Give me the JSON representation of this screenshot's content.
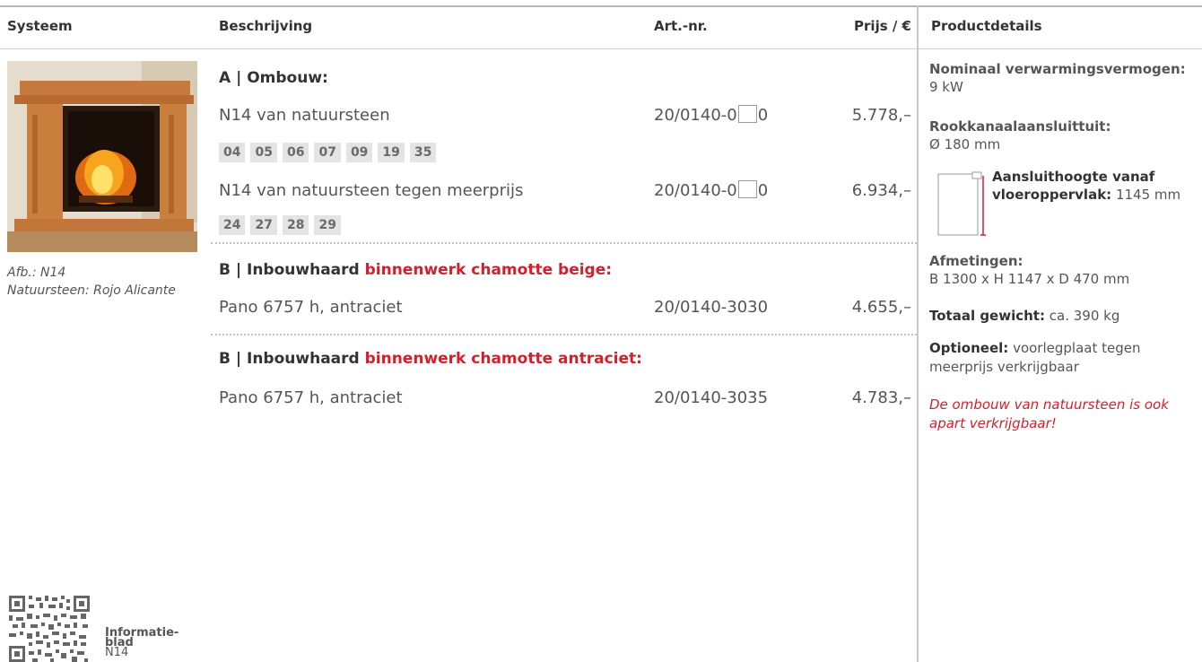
{
  "header": {
    "col_system": "Systeem",
    "col_description": "Beschrijving",
    "col_art": "Art.-nr.",
    "col_price": "Prijs / €",
    "col_details": "Productdetails"
  },
  "image": {
    "caption_line1": "Afb.: N14",
    "caption_line2": "Natuursteen: Rojo Alicante"
  },
  "section_a": {
    "title": "A | Ombouw:",
    "rows": [
      {
        "desc": "N14 van natuursteen",
        "art_prefix": "20/0140-0",
        "art_suffix": "0",
        "price": "5.778,–"
      },
      {
        "desc": "N14 van natuursteen tegen meerprijs",
        "art_prefix": "20/0140-0",
        "art_suffix": "0",
        "price": "6.934,–"
      }
    ],
    "codes_1": [
      "04",
      "05",
      "06",
      "07",
      "09",
      "19",
      "35"
    ],
    "codes_2": [
      "24",
      "27",
      "28",
      "29"
    ]
  },
  "section_b1": {
    "title_prefix": "B | Inbouwhaard ",
    "title_highlight": "binnenwerk chamotte beige:",
    "desc": "Pano 6757 h, antraciet",
    "art": "20/0140-3030",
    "price": "4.655,–"
  },
  "section_b2": {
    "title_prefix": "B | Inbouwhaard ",
    "title_highlight": "binnenwerk chamotte antraciet:",
    "desc": "Pano 6757 h, antraciet",
    "art": "20/0140-3035",
    "price": "4.783,–"
  },
  "details": {
    "heat_label": "Nominaal verwarmingsvermogen:",
    "heat_value": "9 kW",
    "flue_label": "Rookkanaalaansluittuit:",
    "flue_value": "Ø 180 mm",
    "height_label": "Aansluithoogte vanaf vloeroppervlak:",
    "height_value": "1145 mm",
    "dims_label": "Afmetingen:",
    "dims_value": "B 1300 x H 1147 x D 470 mm",
    "weight_label": "Totaal gewicht:",
    "weight_value": "ca. 390 kg",
    "optional_label": "Optioneel:",
    "optional_value": "voorlegplaat tegen meerprijs verkrijgbaar",
    "note": "De ombouw van natuursteen is ook apart verkrijgbaar!"
  },
  "qr": {
    "label_line1": "Informatie-",
    "label_line2": "blad",
    "label_line3": "N14"
  },
  "colors": {
    "accent_red": "#d4202c",
    "chip_bg": "#e4e4e4",
    "text": "#555555"
  }
}
